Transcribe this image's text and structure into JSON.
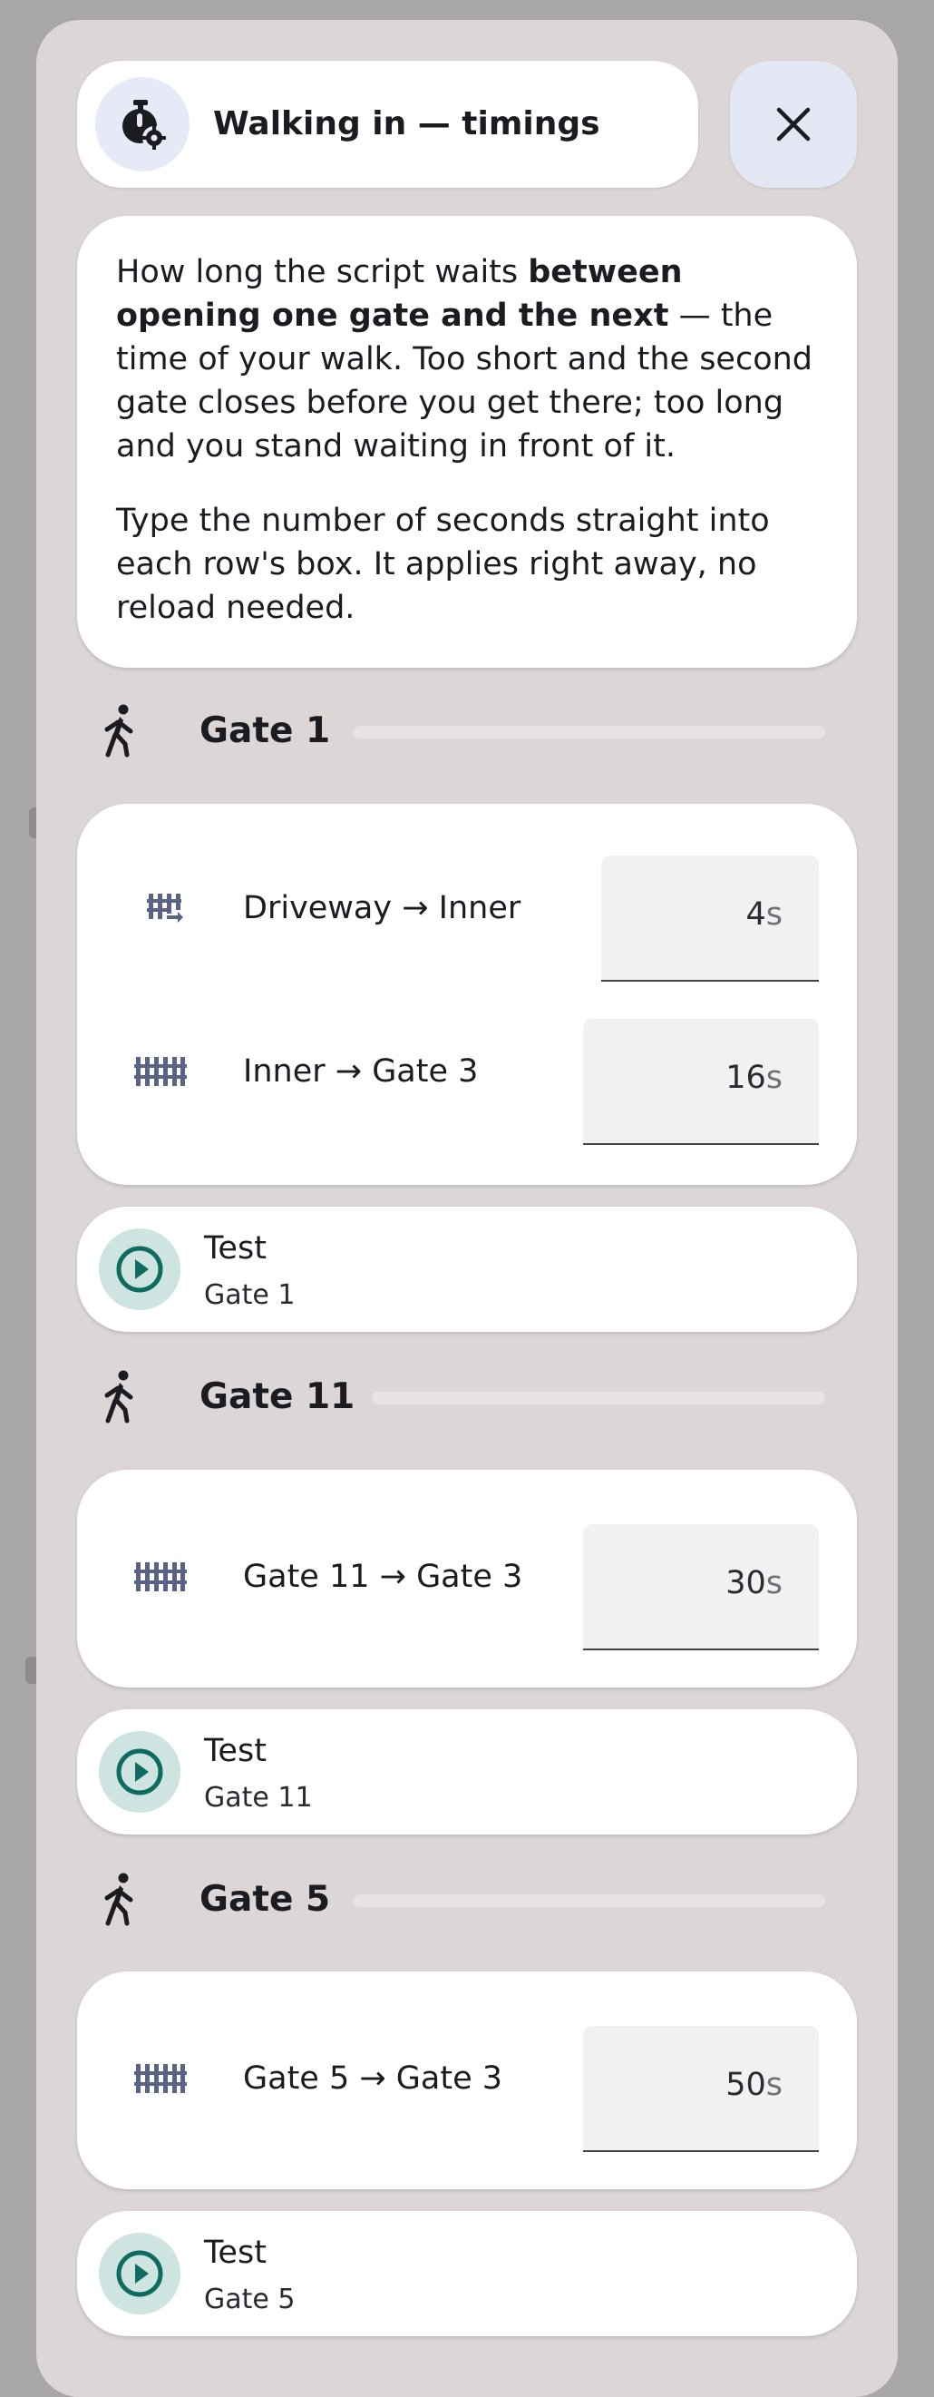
{
  "header": {
    "title": "Walking in — timings",
    "badge_icon": "timer-gear-icon",
    "close_icon": "close-icon"
  },
  "intro": {
    "p1_part1": "How long the script waits ",
    "p1_bold": "between opening one gate and the next",
    "p1_part2": " — the time of your walk. Too short and the second gate closes before you get there; too long and you stand waiting in front of it.",
    "p2": "Type the number of seconds straight into each row's box. It applies right away, no reload needed."
  },
  "unit": "s",
  "sections": [
    {
      "name": "Gate 1",
      "rows": [
        {
          "label": "Driveway → Inner",
          "value": "4",
          "icon": "gate-arrow-icon"
        },
        {
          "label": "Inner → Gate 3",
          "value": "16",
          "icon": "fence-icon"
        }
      ],
      "test": {
        "label": "Test",
        "sub": "Gate 1"
      }
    },
    {
      "name": "Gate 11",
      "rows": [
        {
          "label": "Gate 11 → Gate 3",
          "value": "30",
          "icon": "fence-icon"
        }
      ],
      "test": {
        "label": "Test",
        "sub": "Gate 11"
      }
    },
    {
      "name": "Gate 5",
      "rows": [
        {
          "label": "Gate 5 → Gate 3",
          "value": "50",
          "icon": "fence-icon"
        }
      ],
      "test": {
        "label": "Test",
        "sub": "Gate 5"
      }
    }
  ],
  "colors": {
    "backdrop": "#a9a6a6",
    "sheet": "#dcd7d6",
    "accent_teal": "#0f6b5f",
    "icon_slate": "#5b6384"
  }
}
